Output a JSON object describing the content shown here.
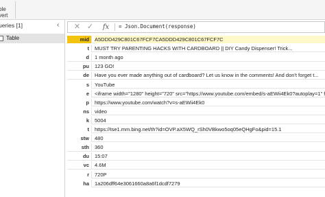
{
  "ribbon": {
    "fragment_1": "",
    "fragment_2": "ble",
    "fragment_3": "vert"
  },
  "queries": {
    "title": "ueries [1]",
    "collapse_glyph": "‹",
    "items": [
      {
        "label": "Table"
      }
    ]
  },
  "formula_bar": {
    "cancel_glyph": "✕",
    "ok_glyph": "✓",
    "fx_label": "fx",
    "formula": "= Json.Document(response)"
  },
  "record": [
    {
      "key": "mid",
      "value": "A5DDD429C801C67FCF7CA5DDD429C801C67FCF7C"
    },
    {
      "key": "t",
      "value": "MUST TRY PARENTING HACKS WITH CARDBOARD || DIY Candy Dispenser! Trick..."
    },
    {
      "key": "d",
      "value": "1 month ago"
    },
    {
      "key": "pu",
      "value": "123 GO!"
    },
    {
      "key": "de",
      "value": "Have you ever made anything out of cardboard? Let us know in the comments! And don't forget t..."
    },
    {
      "key": "s",
      "value": "YouTube"
    },
    {
      "key": "e",
      "value": "<iframe width=\"1280\" height=\"720\" src=\"https://www.youtube.com/embed/s-aEWii4Ek0?autoplay=1\" frameborde"
    },
    {
      "key": "p",
      "value": "https://www.youtube.com/watch?v=s-aEWii4Ek0"
    },
    {
      "key": "ns",
      "value": "video"
    },
    {
      "key": "k",
      "value": "5004"
    },
    {
      "key": "t",
      "value": "https://tse1.mm.bing.net/th?id=OVP.aX5WQ_rSh0VBkwo5oq05eQHgFo&pid=15.1"
    },
    {
      "key": "stw",
      "value": "480"
    },
    {
      "key": "sth",
      "value": "360"
    },
    {
      "key": "du",
      "value": "15:07"
    },
    {
      "key": "vc",
      "value": "4.6M"
    },
    {
      "key": "r",
      "value": "720P"
    },
    {
      "key": "ha",
      "value": "1a206dff64e3061660a8a6f1dcdf7279"
    }
  ]
}
